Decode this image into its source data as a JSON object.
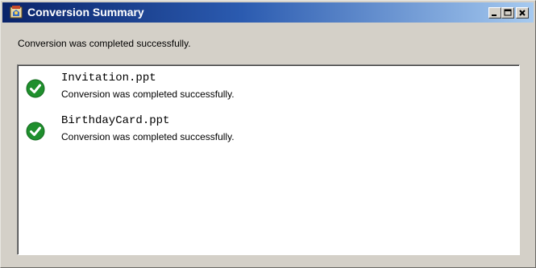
{
  "window": {
    "title": "Conversion Summary",
    "controls": {
      "minimize": "minimize-icon",
      "maximize": "maximize-icon",
      "close": "close-icon"
    }
  },
  "summary": {
    "message": "Conversion was completed successfully."
  },
  "results": [
    {
      "file": "Invitation.ppt",
      "status": "Conversion was completed successfully.",
      "icon": "check-circle-icon"
    },
    {
      "file": "BirthdayCard.ppt",
      "status": "Conversion was completed successfully.",
      "icon": "check-circle-icon"
    }
  ],
  "colors": {
    "titlebar_start": "#0a246a",
    "titlebar_end": "#a6caf0",
    "window_face": "#d4d0c8",
    "success_green": "#1f8f2d"
  }
}
